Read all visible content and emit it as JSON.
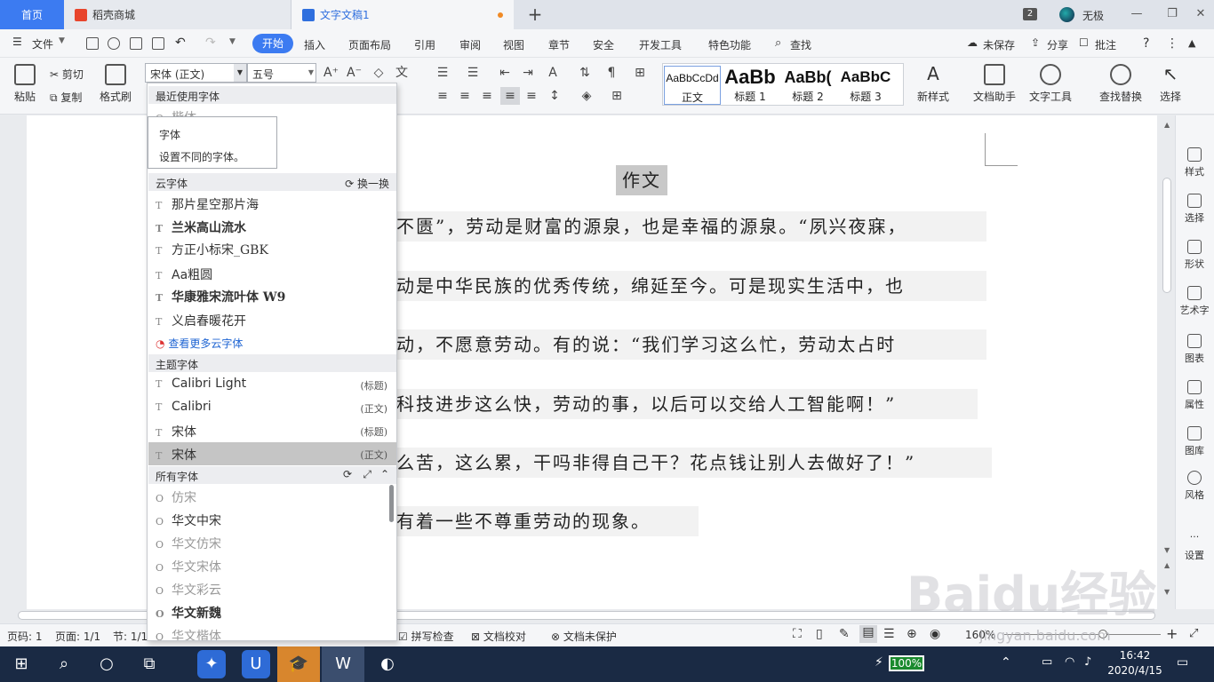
{
  "tabs": {
    "home": "首页",
    "store": "稻壳商城",
    "doc": "文字文稿1",
    "plus": "+",
    "badge": "2",
    "user": "无极"
  },
  "menubar": {
    "file": "文件",
    "items": [
      "开始",
      "插入",
      "页面布局",
      "引用",
      "审阅",
      "视图",
      "章节",
      "安全",
      "开发工具",
      "特色功能"
    ],
    "search": "查找",
    "unsaved": "未保存",
    "share": "分享",
    "comment": "批注"
  },
  "ribbon": {
    "paste": "粘贴",
    "cut": "剪切",
    "copy": "复制",
    "format_painter": "格式刷",
    "font_name": "宋体 (正文)",
    "font_size": "五号",
    "styles": [
      {
        "sample": "AaBbCcDd",
        "label": "正文"
      },
      {
        "sample": "AaBb",
        "label": "标题 1"
      },
      {
        "sample": "AaBb(",
        "label": "标题 2"
      },
      {
        "sample": "AaBbC",
        "label": "标题 3"
      }
    ],
    "new_style": "新样式",
    "doc_assistant": "文档助手",
    "text_tools": "文字工具",
    "find_replace": "查找替换",
    "select": "选择"
  },
  "document": {
    "title": "作文",
    "lines": [
      "不匮”，劳动是财富的源泉，也是幸福的源泉。“夙兴夜寐，",
      "动是中华民族的优秀传统，绵延至今。可是现实生活中，也",
      "动，不愿意劳动。有的说：“我们学习这么忙，劳动太占时",
      "科技进步这么快，劳动的事，以后可以交给人工智能啊！”",
      "么苦，这么累，干吗非得自己干？花点钱让别人去做好了！”",
      "有着一些不尊重劳动的现象。"
    ]
  },
  "right_panel": [
    "样式",
    "选择",
    "形状",
    "艺术字",
    "图表",
    "属性",
    "图库",
    "风格",
    "设置"
  ],
  "font_dropdown": {
    "recent_header": "最近使用字体",
    "recent_item": "楷体",
    "tooltip_title": "字体",
    "tooltip_desc": "设置不同的字体。",
    "cloud_header": "云字体",
    "cloud_refresh": "换一换",
    "cloud_fonts": [
      "那片星空那片海",
      "兰米高山流水",
      "方正小标宋_GBK",
      "Aa粗圆",
      "华康雅宋流叶体 W9",
      "义启春暖花开"
    ],
    "more_cloud": "查看更多云字体",
    "theme_header": "主题字体",
    "theme_fonts": [
      {
        "name": "Calibri Light",
        "tag": "(标题)"
      },
      {
        "name": "Calibri",
        "tag": "(正文)"
      },
      {
        "name": "宋体",
        "tag": "(标题)"
      },
      {
        "name": "宋体",
        "tag": "(正文)"
      }
    ],
    "all_header": "所有字体",
    "all_fonts": [
      "仿宋",
      "华文中宋",
      "华文仿宋",
      "华文宋体",
      "华文彩云",
      "华文新魏",
      "华文楷体"
    ]
  },
  "statusbar": {
    "page_num": "页码: 1",
    "pages": "页面: 1/1",
    "section": "节: 1/1",
    "spell": "拼写检查",
    "proof": "文档校对",
    "protect": "文档未保护",
    "zoom": "160%"
  },
  "taskbar": {
    "battery": "100%",
    "time": "16:42",
    "date": "2020/4/15"
  },
  "watermark": {
    "logo": "Baidu经验",
    "url": "jingyan.baidu.com"
  }
}
